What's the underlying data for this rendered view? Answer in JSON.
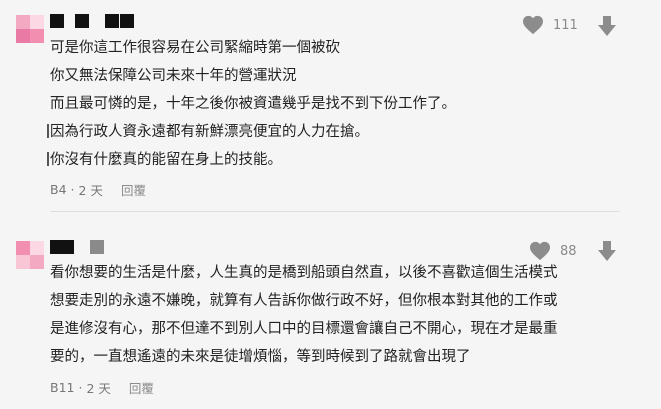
{
  "comments": [
    {
      "likes": "111",
      "lines": [
        "可是你這工作很容易在公司緊縮時第一個被砍",
        "你又無法保障公司未來十年的營運狀況",
        "而且最可憐的是，十年之後你被資遣幾乎是找不到下份工作了。",
        "因為行政人資永遠都有新鮮漂亮便宜的人力在搶。",
        "你沒有什麼真的能留在身上的技能。"
      ],
      "floor": "B4",
      "sep": "·",
      "time": "2 天",
      "reply": "回覆"
    },
    {
      "likes": "88",
      "lines": [
        "看你想要的生活是什麼，人生真的是橋到船頭自然直，以後不喜歡這個生活模式",
        "想要走別的永遠不嫌晚，就算有人告訴你做行政不好，但你根本對其他的工作或",
        "是進修沒有心，那不但達不到別人口中的目標還會讓自己不開心，現在才是最重",
        "要的，一直想遙遠的未來是徒增煩惱，等到時候到了路就會出現了"
      ],
      "floor": "B11",
      "sep": "·",
      "time": "2 天",
      "reply": "回覆"
    }
  ],
  "colors": {
    "avatar_pink": "#f28fb0",
    "avatar_light": "#f9c6d6",
    "icon_gray": "#8c8c8c",
    "text": "#222222",
    "meta": "#777777"
  },
  "icons": [
    "heart-icon",
    "thumb-down-arrow-icon"
  ]
}
